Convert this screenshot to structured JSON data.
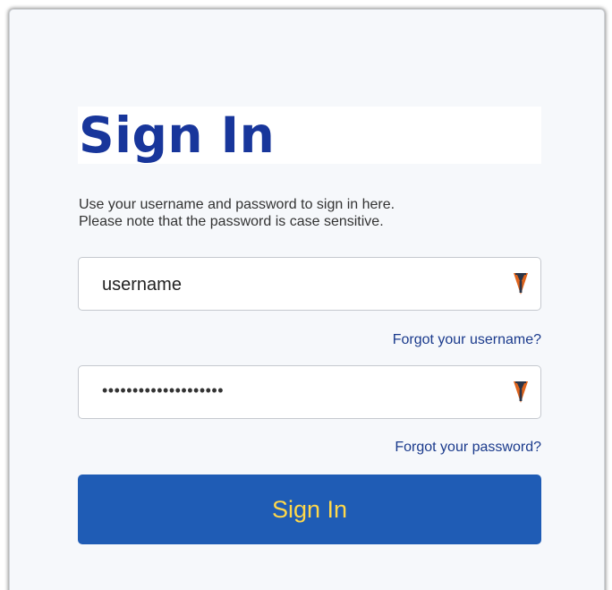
{
  "form": {
    "title": "Sign In",
    "instructions": [
      "Use your username and password to sign in here.",
      "Please note that the password is case sensitive."
    ],
    "username_value": "username",
    "password_value": "••••••••••••••••••••",
    "field_icon": "key-icon",
    "forgot_username_label": "Forgot your username?",
    "forgot_password_label": "Forgot your password?",
    "submit_label": "Sign In"
  },
  "colors": {
    "title": "#18369b",
    "button_background": "#1f5cb5",
    "button_text": "#ffd84a",
    "link": "#1a3a8c",
    "card_background": "#f6f8fb",
    "icon_primary": "#e0641c",
    "icon_secondary": "#2b3548"
  }
}
